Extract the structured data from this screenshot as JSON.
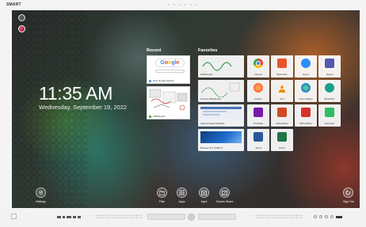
{
  "brand": "SMART",
  "home": {
    "time": "11:35 AM",
    "date": "Wednesday, September 19, 2022"
  },
  "recent": {
    "title": "Recent",
    "items": [
      {
        "label": "New Google Search",
        "app": "Google"
      },
      {
        "label": "Whiteboard"
      }
    ]
  },
  "favorites": {
    "title": "Favorites",
    "items": [
      {
        "label": "Whiteboard",
        "icon": "whiteboard-icon"
      },
      {
        "label": "Chrome",
        "icon": "chrome-icon"
      },
      {
        "label": "Web Files",
        "icon": "web-files-icon",
        "color": "#e8542c"
      },
      {
        "label": "Zoom",
        "icon": "zoom-icon",
        "color": "#2d8cff"
      },
      {
        "label": "Teams",
        "icon": "teams-icon",
        "color": "#5558af"
      },
      {
        "label": "Ground Whiteboard",
        "icon": "ground-whiteboard-icon"
      },
      {
        "label": "Firefox",
        "icon": "firefox-icon",
        "color": "#ff7139"
      },
      {
        "label": "VLC",
        "icon": "vlc-icon",
        "color": "#f08a00"
      },
      {
        "label": "Cisco Webex",
        "icon": "webex-icon",
        "color": "#1b7fcc"
      },
      {
        "label": "BoardTec",
        "icon": "boardtec-icon",
        "color": "#1aa08a"
      },
      {
        "label": "Search Saved Website",
        "icon": "saved-website-icon"
      },
      {
        "label": "OneNote",
        "icon": "onenote-icon",
        "color": "#7719aa"
      },
      {
        "label": "PowerPoint",
        "icon": "powerpoint-icon",
        "color": "#d24726"
      },
      {
        "label": "WPS Office",
        "icon": "wps-office-icon",
        "color": "#d4322b"
      },
      {
        "label": "Evernote",
        "icon": "evernote-icon",
        "color": "#2dbe60"
      },
      {
        "label": "Browser PC (USB-C)",
        "icon": "browser-pc-icon"
      },
      {
        "label": "Word",
        "icon": "word-icon",
        "color": "#2b579a"
      },
      {
        "label": "Excel",
        "icon": "excel-icon",
        "color": "#217346"
      }
    ]
  },
  "dock": {
    "settings": "Settings",
    "files": "Files",
    "apps": "Apps",
    "input": "Input",
    "screen_share": "Screen Share",
    "sign_out": "Sign Out"
  }
}
